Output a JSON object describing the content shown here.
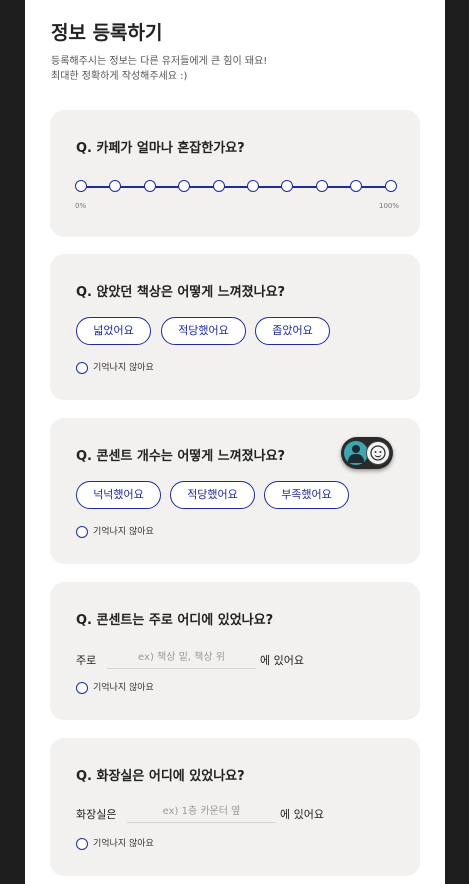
{
  "header": {
    "title": "정보 등록하기",
    "subtitle_line1": "등록해주시는 정보는 다른 유저들에게 큰 힘이 돼요!",
    "subtitle_line2": "최대한 정확하게 작성해주세요 :)"
  },
  "q1": {
    "question": "Q. 카페가 얼마나 혼잡한가요?",
    "slider_min": "0%",
    "slider_max": "100%",
    "steps": 10
  },
  "q2": {
    "question": "Q. 앉았던 책상은 어떻게 느껴졌나요?",
    "options": [
      "넓었어요",
      "적당했어요",
      "좁았어요"
    ],
    "not_remember": "기억나지 않아요"
  },
  "q3": {
    "question": "Q. 콘센트 개수는 어떻게 느껴졌나요?",
    "options": [
      "넉넉했어요",
      "적당했어요",
      "부족했어요"
    ],
    "not_remember": "기억나지 않아요"
  },
  "q4": {
    "question": "Q. 콘센트는 주로 어디에 있었나요?",
    "prefix": "주로",
    "placeholder": "ex) 책상 밑, 책상 위",
    "suffix": "에 있어요",
    "not_remember": "기억나지 않아요"
  },
  "q5": {
    "question": "Q. 화장실은 어디에 있었나요?",
    "prefix": "화장실은",
    "placeholder": "ex) 1층 카운터 옆",
    "suffix": "에 있어요",
    "not_remember": "기억나지 않아요"
  },
  "colors": {
    "accent": "#1f2c9c",
    "card_bg": "#f2f1ef",
    "page_bg": "#ffffff",
    "outer_bg": "#1e1e1e"
  },
  "icons": {
    "floating_button": "avatar-chat-icon",
    "option_radio": "radio-circle-icon"
  }
}
